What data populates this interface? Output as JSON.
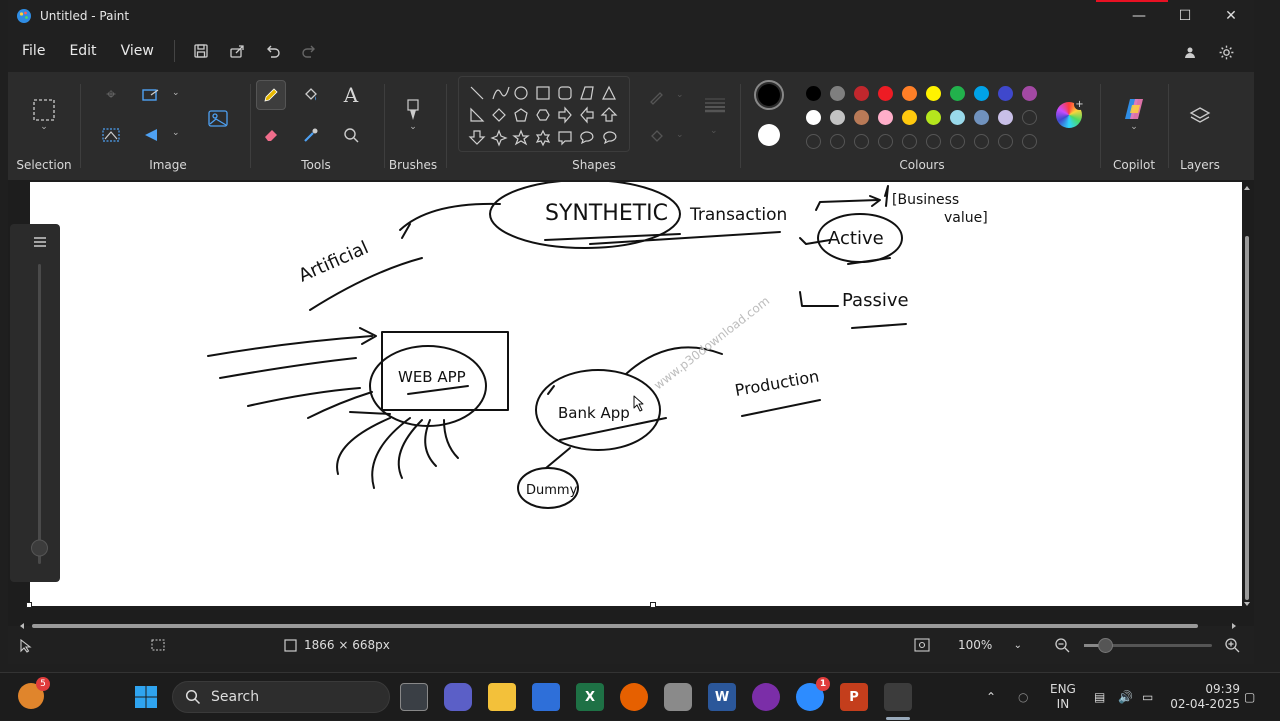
{
  "window": {
    "title": "Untitled - Paint"
  },
  "menu": {
    "file": "File",
    "edit": "Edit",
    "view": "View"
  },
  "ribbon": {
    "groups": {
      "selection": "Selection",
      "image": "Image",
      "tools": "Tools",
      "brushes": "Brushes",
      "shapes": "Shapes",
      "colours": "Colours",
      "copilot": "Copilot",
      "layers": "Layers"
    },
    "tools_text_glyph": "A",
    "palette_row1": [
      "#000000",
      "#7f7f7f",
      "#c1272d",
      "#ed1c24",
      "#ff7f27",
      "#fff200",
      "#22b14c",
      "#00a2e8",
      "#3f48cc",
      "#a349a4"
    ],
    "palette_row2": [
      "#ffffff",
      "#c3c3c3",
      "#b97a57",
      "#ffaec9",
      "#ffc90e",
      "#b5e61d",
      "#99d9ea",
      "#7092be",
      "#c8bfe7"
    ],
    "primary_color": "#000000",
    "secondary_color": "#ffffff"
  },
  "canvas": {
    "handwriting": {
      "synthetic": "SYNTHETIC",
      "transaction": "Transaction",
      "business": "[Business",
      "value": "value]",
      "active": "Active",
      "passive": "Passive",
      "artificial": "Artificial",
      "webapp": "WEB APP",
      "bankapp": "Bank App",
      "dummy": "Dummy",
      "production": "Production"
    },
    "watermark": "www.p30download.com"
  },
  "status": {
    "dimensions": "1866 × 668px",
    "zoom": "100%"
  },
  "taskbar": {
    "search_placeholder": "Search",
    "notification_badge": "5",
    "zoom_badge": "1",
    "language_line1": "ENG",
    "language_line2": "IN",
    "time": "09:39",
    "date": "02-04-2025"
  }
}
